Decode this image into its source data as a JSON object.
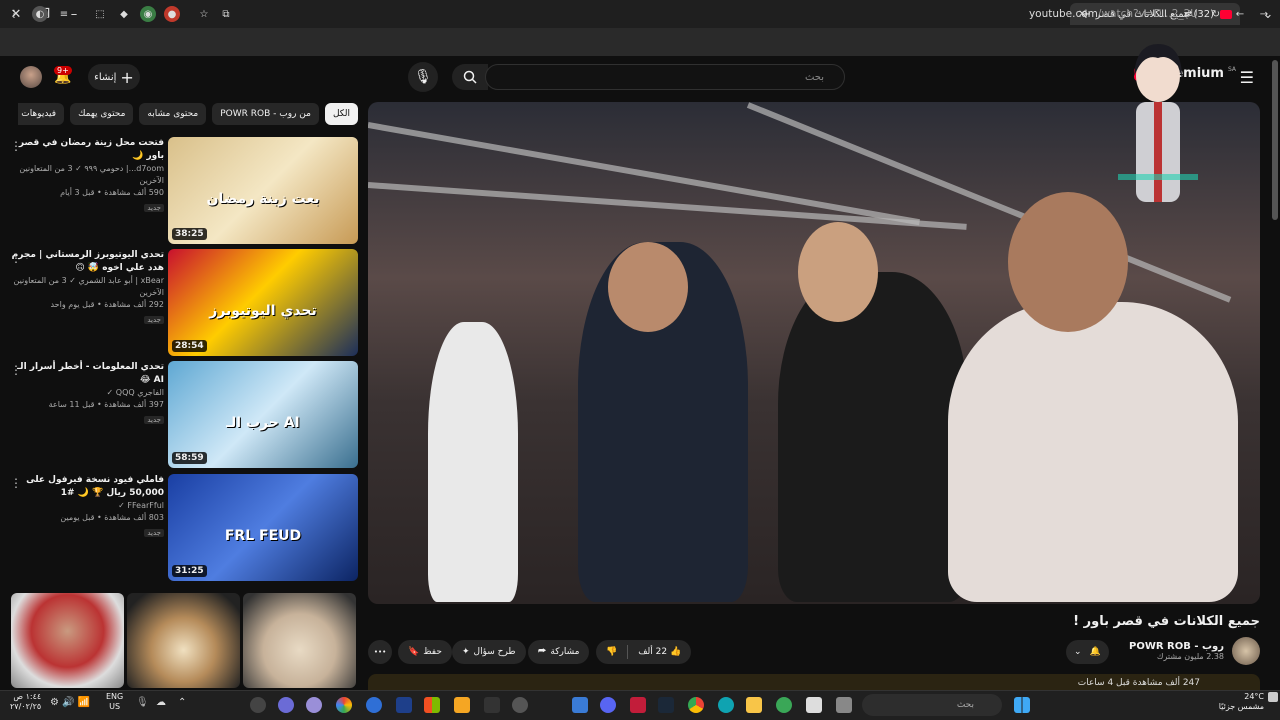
{
  "browser": {
    "tab_title": "(32) جميع الكلانات في قصر باور !",
    "url_host": "youtube.com",
    "url_path": "/watch?v=D...2_2U",
    "new_tab": "+",
    "minimize": "–",
    "restore": "❐",
    "close": "✕"
  },
  "header": {
    "notif_count": "9+",
    "create_label": "إنشاء",
    "search_placeholder": "بحث",
    "logo_text": "Premium",
    "logo_region": "SA"
  },
  "chips": [
    "الكل",
    "من روب - POWR ROB",
    "محتوى مشابه",
    "محتوى يهمك",
    "فيديوهات محتـ"
  ],
  "sidebar": {
    "items": [
      {
        "title": "فتحت محل زينة رمضان في قصر باور 🌙",
        "channel": "d7oom...| دحومي ٩٩٩ ✓ 3 من المتعاونين الآخرين",
        "views": "590 ألف مشاهدة • قبل 3 أيام",
        "badge": "جديد",
        "duration": "38:25",
        "overlay": "بعت زينة رمضان"
      },
      {
        "title": "تحدي اليوتيوبرز الرمستاني | مجرم هدد علي اخوه 🤯 🙃",
        "channel": "xBear | أبو عابد الشمري ✓ 3 من المتعاونين الآخرين",
        "views": "292 ألف مشاهدة • قبل يوم واحد",
        "badge": "جديد",
        "duration": "28:54",
        "overlay": "تحدي اليوتيوبرز"
      },
      {
        "title": "تحدي المعلومات - أخطر أسرار الـ AI 😂",
        "channel": "الفاجري QQQ ✓",
        "views": "397 ألف مشاهدة • قبل 11 ساعة",
        "badge": "جديد",
        "duration": "58:59",
        "overlay": "حرب الـ AI"
      },
      {
        "title": "فاملي فيود نسخة فيرفول على 50,000 ريال 🏆 🌙 #1",
        "channel": "FFearFful ✓",
        "views": "803 ألف مشاهدة • قبل يومين",
        "badge": "جديد",
        "duration": "31:25",
        "overlay": "FRL FEUD"
      }
    ]
  },
  "video": {
    "title": "جميع الكلانات في قصر باور !",
    "channel_name": "روب - POWR ROB",
    "subscribers": "2.38 مليون مشترك",
    "likes": "22 ألف",
    "share": "مشاركة",
    "ask": "طرح سؤال",
    "save": "حفظ",
    "more": "•••",
    "description_peek": "247 ألف مشاهدة قبل 4 ساعات"
  },
  "taskbar": {
    "search": "بحث",
    "weather_temp": "24°C",
    "weather_desc": "مشمس جزئيًا",
    "clock_time": "١:٤٤ ص",
    "clock_date": "٢٧/٠٢/٢٥",
    "lang_top": "ENG",
    "lang_bottom": "US"
  },
  "colors": {
    "accent": "#ff0033",
    "bg": "#0f0f0f",
    "chip": "#272727"
  }
}
